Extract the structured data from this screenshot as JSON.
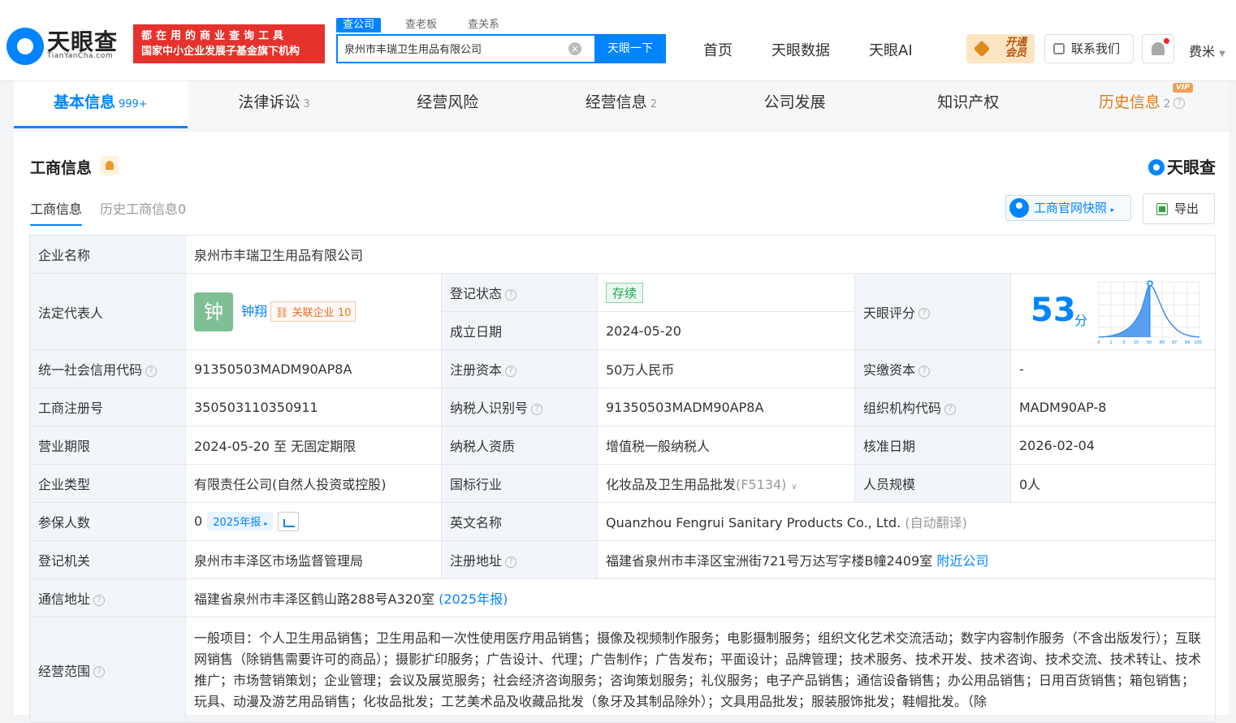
{
  "header": {
    "logo_text": "天眼查",
    "logo_sub": "TianYanCha.com",
    "slogan_line1": "都在用的商业查询工具",
    "slogan_line2": "国家中小企业发展子基金旗下机构",
    "search_tabs": [
      "查公司",
      "查老板",
      "查关系"
    ],
    "search_value": "泉州市丰瑞卫生用品有限公司",
    "search_button": "天眼一下",
    "nav": [
      "首页",
      "天眼数据",
      "天眼AI"
    ],
    "vip_open_l1": "开通",
    "vip_open_l2": "会员",
    "contact": "联系我们",
    "user": "费米"
  },
  "tabs": [
    {
      "label": "基本信息",
      "count": "999+"
    },
    {
      "label": "法律诉讼",
      "count": "3"
    },
    {
      "label": "经营风险",
      "count": ""
    },
    {
      "label": "经营信息",
      "count": "2"
    },
    {
      "label": "公司发展",
      "count": ""
    },
    {
      "label": "知识产权",
      "count": ""
    },
    {
      "label": "历史信息",
      "count": "2",
      "vip": "VIP"
    }
  ],
  "section": {
    "title": "工商信息",
    "brand": "天眼查",
    "subtabs": [
      "工商信息",
      "历史工商信息0"
    ],
    "snapshot_btn": "工商官网快照",
    "export_btn": "导出"
  },
  "info": {
    "company_name_k": "企业名称",
    "company_name": "泉州市丰瑞卫生用品有限公司",
    "legal_rep_k": "法定代表人",
    "legal_rep_avatar": "钟",
    "legal_rep": "钟翔",
    "related_label": "关联企业",
    "related_count": "10",
    "reg_status_k": "登记状态",
    "reg_status": "存续",
    "found_date_k": "成立日期",
    "found_date": "2024-05-20",
    "score_k": "天眼评分",
    "score": "53",
    "score_unit": "分",
    "score_ticks": [
      "0",
      "1",
      "3",
      "15",
      "50",
      "85",
      "97",
      "99",
      "100"
    ],
    "credit_code_k": "统一社会信用代码",
    "credit_code": "91350503MADM90AP8A",
    "reg_capital_k": "注册资本",
    "reg_capital": "50万人民币",
    "paid_capital_k": "实缴资本",
    "paid_capital": "-",
    "reg_no_k": "工商注册号",
    "reg_no": "350503110350911",
    "taxpayer_id_k": "纳税人识别号",
    "taxpayer_id": "91350503MADM90AP8A",
    "org_code_k": "组织机构代码",
    "org_code": "MADM90AP-8",
    "term_k": "营业期限",
    "term": "2024-05-20 至 无固定期限",
    "taxpayer_qual_k": "纳税人资质",
    "taxpayer_qual": "增值税一般纳税人",
    "approve_date_k": "核准日期",
    "approve_date": "2026-02-04",
    "type_k": "企业类型",
    "type": "有限责任公司(自然人投资或控股)",
    "industry_k": "国标行业",
    "industry": "化妆品及卫生用品批发",
    "industry_code": "(F5134)",
    "staff_k": "人员规模",
    "staff": "0人",
    "insured_k": "参保人数",
    "insured": "0",
    "insured_year": "2025年报",
    "en_name_k": "英文名称",
    "en_name": "Quanzhou Fengrui Sanitary Products Co., Ltd.",
    "en_name_note": "(自动翻译)",
    "authority_k": "登记机关",
    "authority": "泉州市丰泽区市场监督管理局",
    "reg_addr_k": "注册地址",
    "reg_addr": "福建省泉州市丰泽区宝洲街721号万达写字楼B幢2409室",
    "nearby": "附近公司",
    "mail_addr_k": "通信地址",
    "mail_addr": "福建省泉州市丰泽区鹤山路288号A320室",
    "mail_addr_note": "(2025年报)",
    "scope_k": "经营范围",
    "scope": "一般项目：个人卫生用品销售；卫生用品和一次性使用医疗用品销售；摄像及视频制作服务；电影摄制服务；组织文化艺术交流活动；数字内容制作服务（不含出版发行）；互联网销售（除销售需要许可的商品）；摄影扩印服务；广告设计、代理；广告制作；广告发布；平面设计；品牌管理；技术服务、技术开发、技术咨询、技术交流、技术转让、技术推广；市场营销策划；企业管理；会议及展览服务；社会经济咨询服务；咨询策划服务；礼仪服务；电子产品销售；通信设备销售；办公用品销售；日用百货销售；箱包销售；玩具、动漫及游艺用品销售；化妆品批发；工艺美术品及收藏品批发（象牙及其制品除外）；文具用品批发；服装服饰批发；鞋帽批发。（除"
  },
  "colors": {
    "brand": "#0084ff",
    "status_green": "#21a55a",
    "history_orange": "#e07b1a",
    "slogan_red": "#e5322d"
  }
}
